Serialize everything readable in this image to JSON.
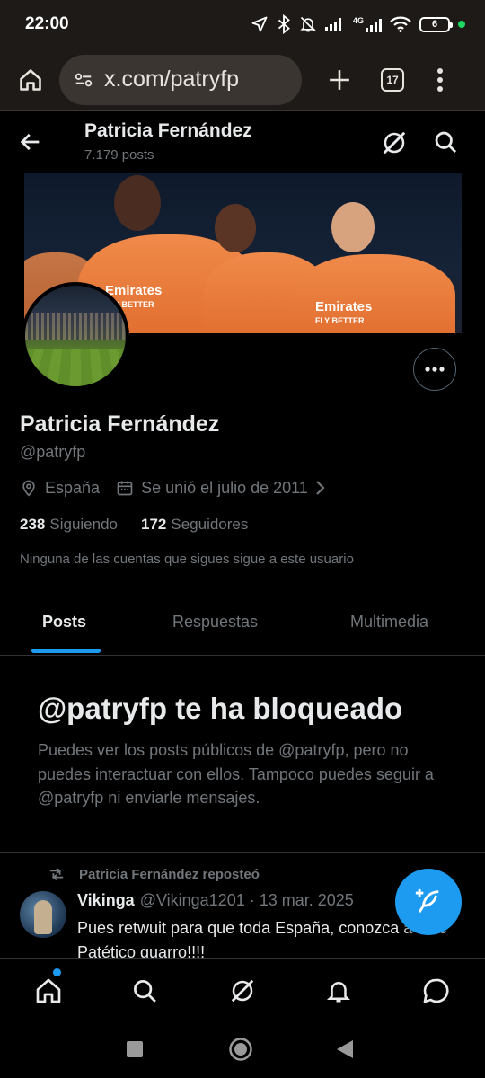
{
  "status": {
    "time": "22:00",
    "network": "4G",
    "battery": "6",
    "icons": [
      "location-arrow-icon",
      "bluetooth-icon",
      "bell-muted-icon",
      "signal-icon",
      "signal-4g-icon",
      "wifi-icon",
      "battery-icon"
    ]
  },
  "browser": {
    "url": "x.com/patryfp",
    "tab_count": "17"
  },
  "header": {
    "name": "Patricia Fernández",
    "post_count": "7.179 posts"
  },
  "profile": {
    "name": "Patricia Fernández",
    "handle": "@patryfp",
    "location": "España",
    "joined": "Se unió el julio de 2011",
    "following_count": "238",
    "following_label": "Siguiendo",
    "followers_count": "172",
    "followers_label": "Seguidores",
    "mutuals_note": "Ninguna de las cuentas que sigues sigue a este usuario"
  },
  "tabs": [
    {
      "label": "Posts",
      "active": true
    },
    {
      "label": "Respuestas",
      "active": false
    },
    {
      "label": "Multimedia",
      "active": false
    }
  ],
  "blocked": {
    "title": "@patryfp te ha bloqueado",
    "body": "Puedes ver los posts públicos de @patryfp, pero no puedes interactuar con ellos. Tampoco puedes seguir a @patryfp ni enviarle mensajes."
  },
  "post": {
    "repost_label": "Patricia Fernández reposteó",
    "author_name": "Vikinga",
    "author_handle": "@Vikinga1201",
    "date": "· 13 mar. 2025",
    "text": "Pues retwuit para que toda España, conozca a este Patético guarro!!!!"
  },
  "banner": {
    "sponsor": "Emirates",
    "tagline": "FLY BETTER"
  },
  "colors": {
    "accent": "#1d9bf0",
    "background": "#000000",
    "text_primary": "#e7e9ea",
    "text_secondary": "#71767b",
    "browser_chrome": "#1d1a17"
  }
}
